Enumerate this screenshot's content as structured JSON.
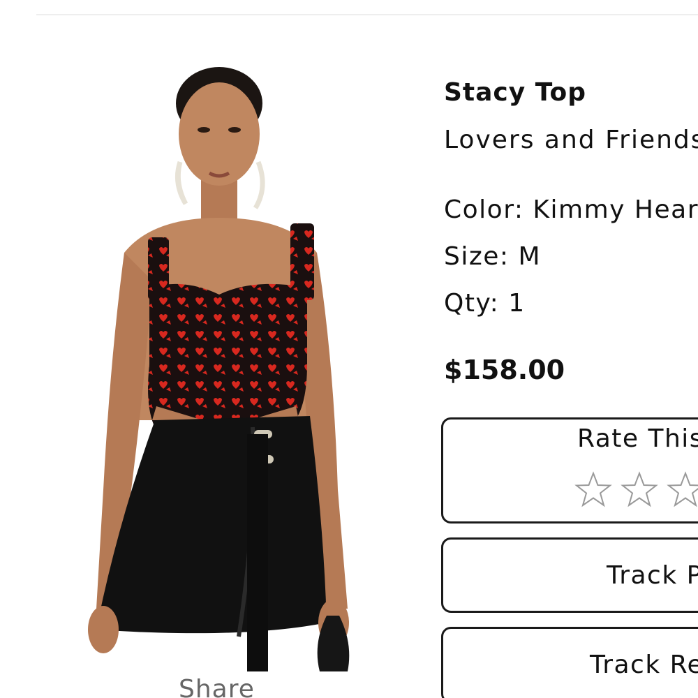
{
  "product": {
    "name": "Stacy Top",
    "brand": "Lovers and Friends",
    "color_label": "Color: Kimmy Heart",
    "size_label": "Size: M",
    "qty_label": "Qty: 1",
    "price": "$158.00",
    "image_alt": "model wearing red and black heart print corset top with black mini skirt"
  },
  "actions": {
    "share": "Share",
    "rate_label": "Rate This",
    "rating": 0,
    "rating_max": 5,
    "track_1": "Track Package",
    "track_2": "Track Return"
  },
  "icons": {
    "star": "star-outline-icon"
  },
  "colors": {
    "border": "#1a1a1a",
    "muted_text": "#666666",
    "star_outline": "#999999",
    "top_red": "#d8281f",
    "skirt_black": "#111111"
  }
}
